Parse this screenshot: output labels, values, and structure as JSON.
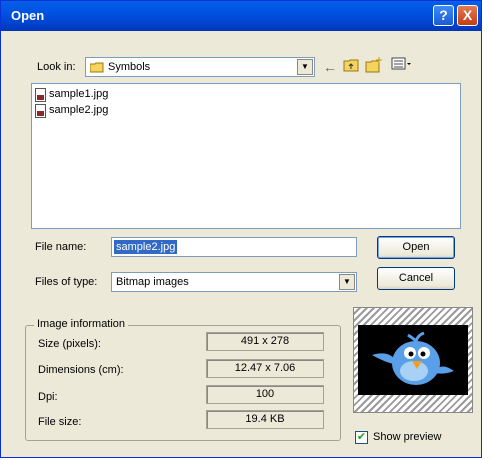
{
  "window": {
    "title": "Open"
  },
  "titlebar": {
    "help_glyph": "?",
    "close_glyph": "X"
  },
  "look_in": {
    "label": "Look in:",
    "value": "Symbols"
  },
  "toolbar_icons": [
    "back-arrow-icon",
    "up-folder-icon",
    "new-folder-icon",
    "views-menu-icon"
  ],
  "files": [
    {
      "name": "sample1.jpg"
    },
    {
      "name": "sample2.jpg"
    }
  ],
  "file_name": {
    "label": "File name:",
    "value": "sample2.jpg"
  },
  "file_type": {
    "label": "Files of type:",
    "value": "Bitmap images"
  },
  "buttons": {
    "open": "Open",
    "cancel": "Cancel"
  },
  "image_info": {
    "title": "Image information",
    "rows": [
      {
        "label": "Size (pixels):",
        "value": "491 x 278"
      },
      {
        "label": "Dimensions (cm):",
        "value": "12.47 x 7.06"
      },
      {
        "label": "Dpi:",
        "value": "100"
      },
      {
        "label": "File size:",
        "value": "19.4 KB"
      }
    ]
  },
  "preview": {
    "show_label": "Show preview",
    "checked": true,
    "check_glyph": "✔"
  },
  "colors": {
    "titlebar": "#0055e5",
    "selection": "#316ac5",
    "bird": "#5aa0e8",
    "beak": "#f0a020"
  }
}
